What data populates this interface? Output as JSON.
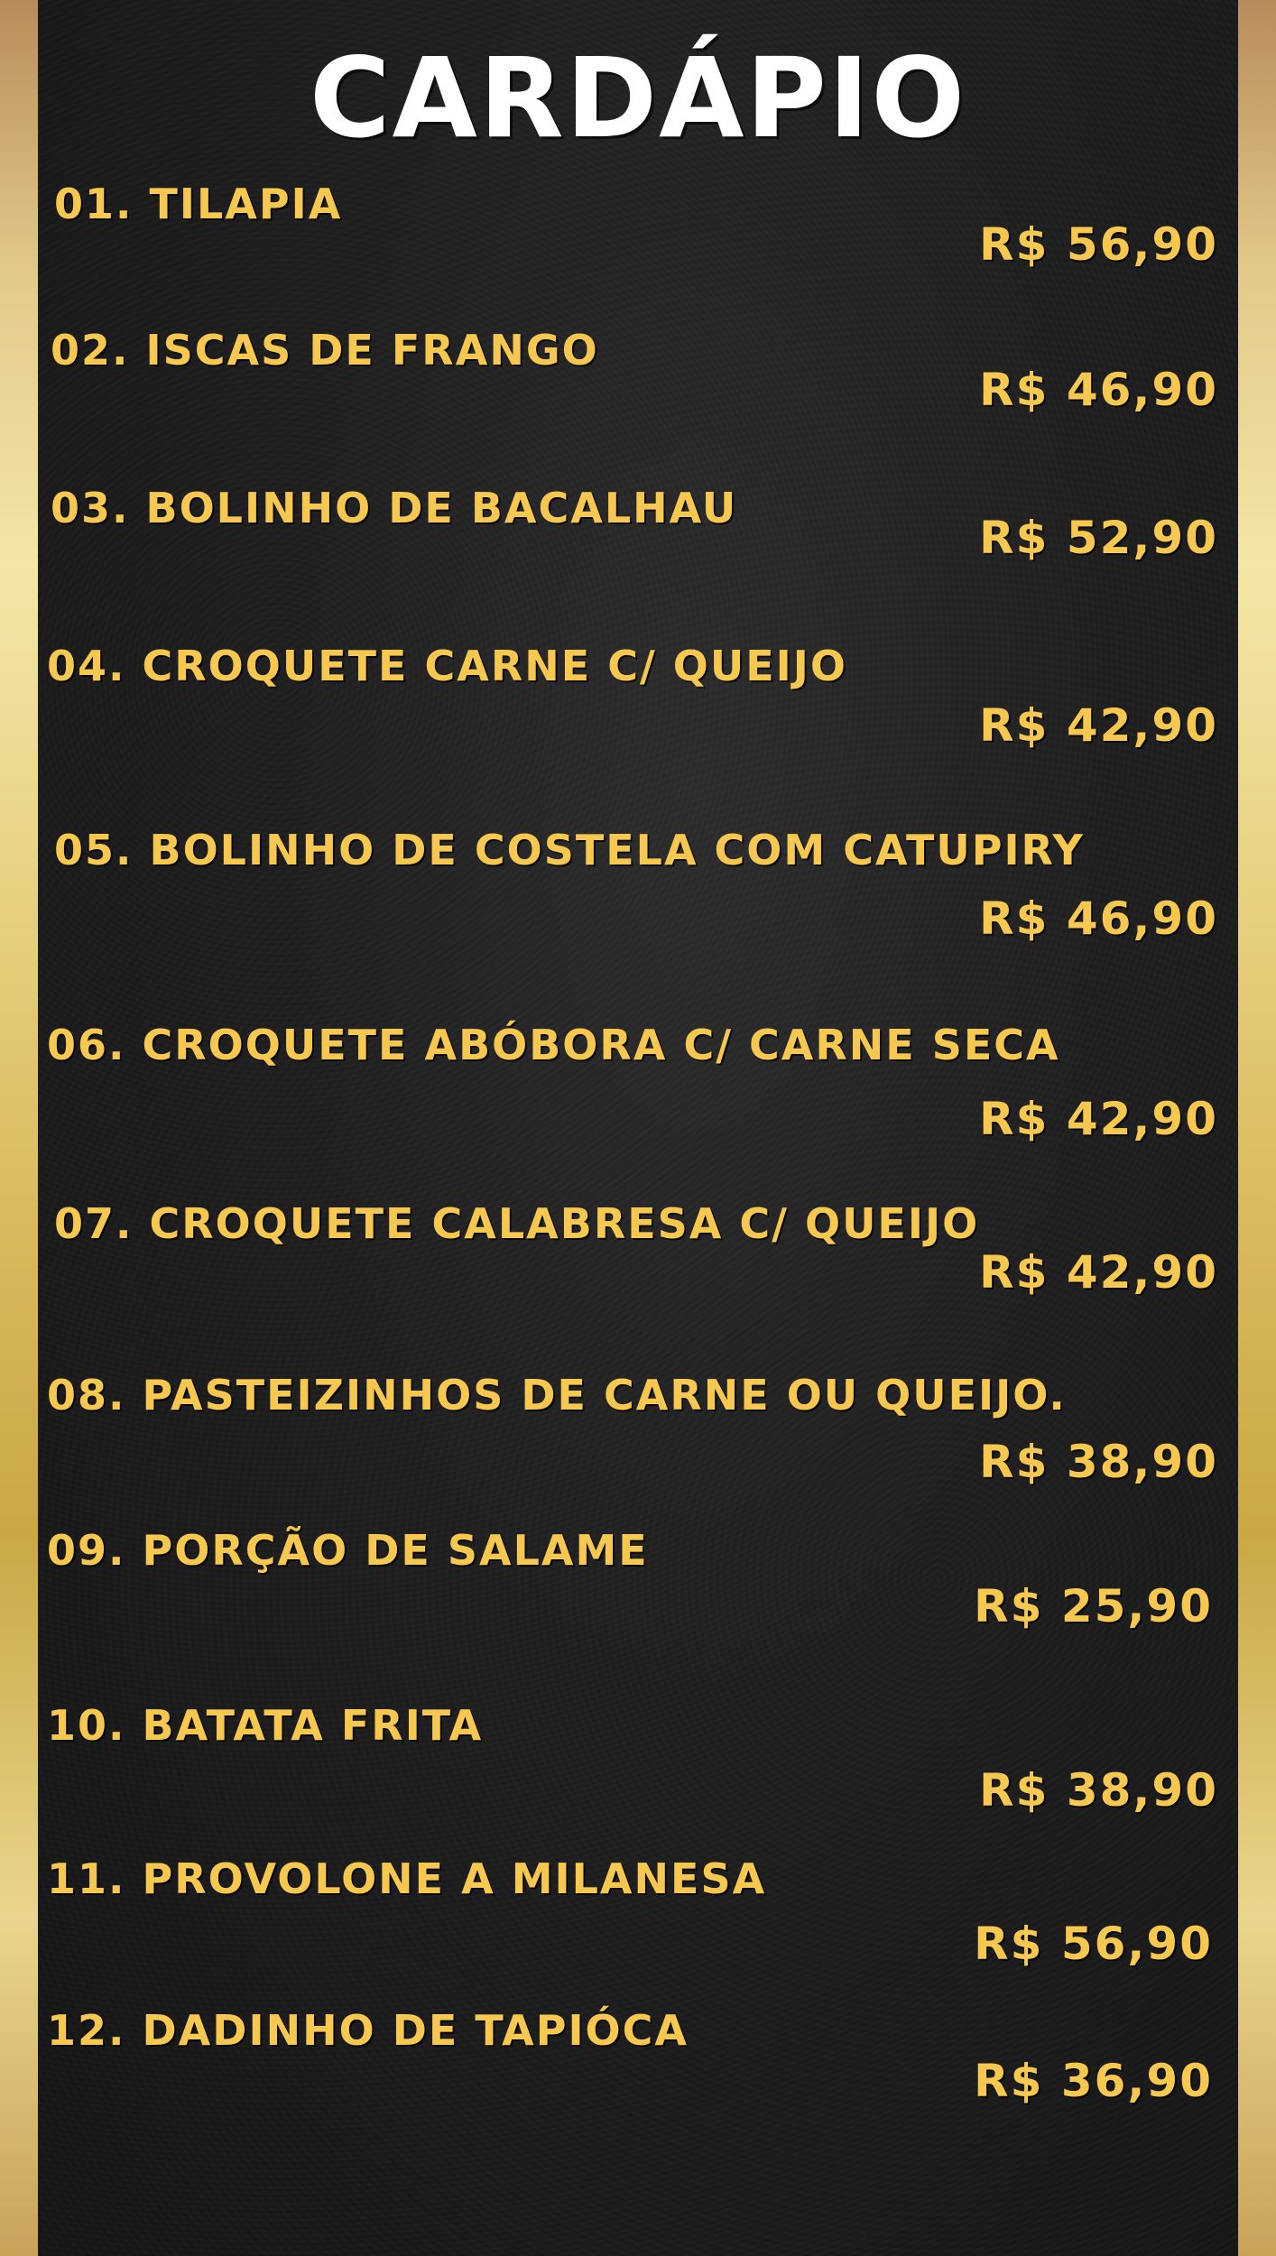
{
  "menu": {
    "title": "CARDÁPIO",
    "items": [
      {
        "name": "01. TILAPIA",
        "price": "R$ 56,90"
      },
      {
        "name": "02. ISCAS DE FRANGO",
        "price": "R$ 46,90"
      },
      {
        "name": "03. BOLINHO DE BACALHAU",
        "price": "R$ 52,90"
      },
      {
        "name": "04. CROQUETE CARNE C/ QUEIJO",
        "price": "R$ 42,90"
      },
      {
        "name": "05. BOLINHO DE COSTELA COM CATUPIRY",
        "price": "R$ 46,90"
      },
      {
        "name": "06. CROQUETE ABÓBORA C/ CARNE SECA",
        "price": "R$ 42,90"
      },
      {
        "name": "07. CROQUETE CALABRESA C/ QUEIJO",
        "price": "R$ 42,90"
      },
      {
        "name": "08. PASTEIZINHOS DE CARNE OU QUEIJO.",
        "price": "R$ 38,90"
      },
      {
        "name": "09. PORÇÃO DE SALAME",
        "price": "R$ 25,90"
      },
      {
        "name": "10. BATATA FRITA",
        "price": "R$ 38,90"
      },
      {
        "name": "11. PROVOLONE A MILANESA",
        "price": "R$ 56,90"
      },
      {
        "name": "12. DADINHO DE TAPIÓCA",
        "price": "R$ 36,90"
      }
    ]
  },
  "colors": {
    "background": "#1a1a1a",
    "title": "#ffffff",
    "item_text": "#f7c850",
    "frame": "#d9b85a"
  }
}
